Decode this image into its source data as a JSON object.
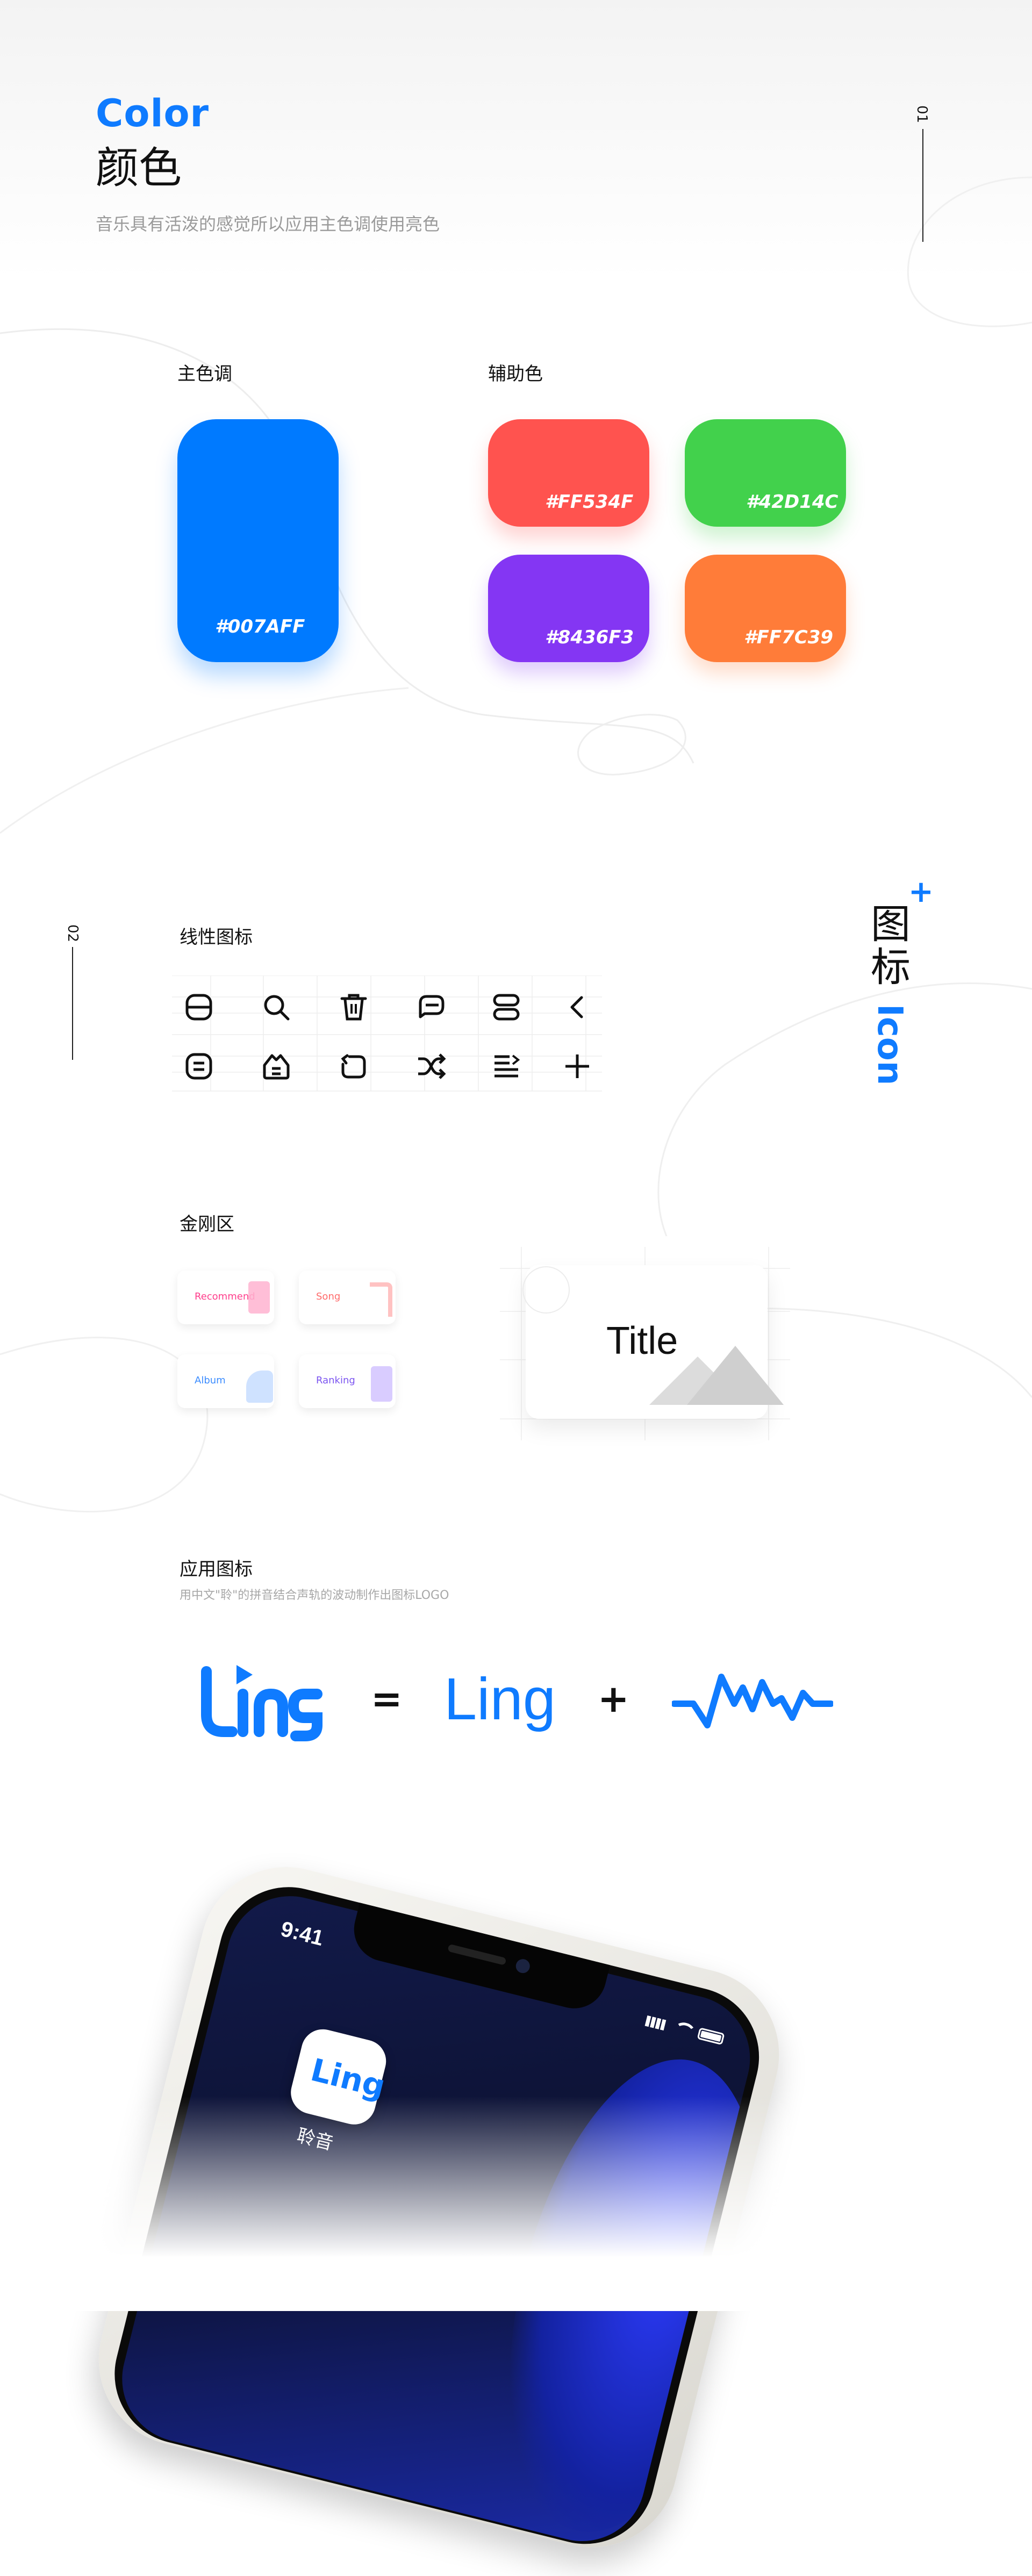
{
  "color_section": {
    "title_en": "Color",
    "title_cn": "颜色",
    "subtitle": "音乐具有活泼的感觉所以应用主色调使用亮色",
    "section_number": "01",
    "primary_label": "主色调",
    "secondary_label": "辅助色",
    "primary": {
      "hex_label": "#007AFF",
      "color": "#007AFF"
    },
    "secondary": [
      {
        "hex_label": "#FF534F",
        "color": "#FF534F"
      },
      {
        "hex_label": "#42D14C",
        "color": "#42D14C"
      },
      {
        "hex_label": "#8436F3",
        "color": "#8436F3"
      },
      {
        "hex_label": "#FF7C39",
        "color": "#FF7C39"
      }
    ]
  },
  "icon_section": {
    "section_number": "02",
    "side_title_cn_1": "图",
    "side_title_cn_2": "标",
    "side_title_en": "Icon",
    "plus": "+",
    "linear_label": "线性图标",
    "icons": [
      "rounded-square-line-icon",
      "search-icon",
      "trash-icon",
      "chat-bubble-icon",
      "stack-icon",
      "chevron-left-icon",
      "list-square-icon",
      "inbox-icon",
      "repeat-icon",
      "shuffle-icon",
      "playlist-icon",
      "plus-icon"
    ],
    "kingkong_label": "金刚区",
    "kingkong_items": [
      {
        "label": "Recommend",
        "color": "#ff3d8b"
      },
      {
        "label": "Song",
        "color": "#ff6a6a"
      },
      {
        "label": "Album",
        "color": "#3b8cff"
      },
      {
        "label": "Ranking",
        "color": "#7b54f0"
      }
    ],
    "card_title": "Title"
  },
  "app_icon_section": {
    "label": "应用图标",
    "description": "用中文\"聆\"的拼音结合声轨的波动制作出图标LOGO",
    "logo_text": "Ling",
    "equals": "=",
    "plus": "+",
    "word_text": "Ling",
    "brand_color": "#0f7bff"
  },
  "phone": {
    "time": "9:41",
    "app_icon_text": "Ling",
    "app_name": "聆音"
  }
}
